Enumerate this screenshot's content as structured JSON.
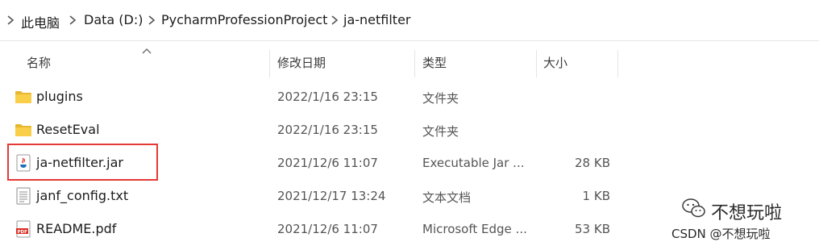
{
  "breadcrumb": {
    "items": [
      "此电脑",
      "Data (D:)",
      "PycharmProfessionProject",
      "ja-netfilter"
    ]
  },
  "columns": {
    "name": "名称",
    "modified": "修改日期",
    "type": "类型",
    "size": "大小"
  },
  "files": [
    {
      "name": "plugins",
      "modified": "2022/1/16 23:15",
      "type": "文件夹",
      "size": "",
      "icon": "folder-icon"
    },
    {
      "name": "ResetEval",
      "modified": "2022/1/16 23:15",
      "type": "文件夹",
      "size": "",
      "icon": "folder-icon"
    },
    {
      "name": "ja-netfilter.jar",
      "modified": "2021/12/6 11:07",
      "type": "Executable Jar ...",
      "size": "28 KB",
      "icon": "java-jar-icon"
    },
    {
      "name": "janf_config.txt",
      "modified": "2021/12/17 13:24",
      "type": "文本文档",
      "size": "1 KB",
      "icon": "text-file-icon"
    },
    {
      "name": "README.pdf",
      "modified": "2021/12/6 11:07",
      "type": "Microsoft Edge ...",
      "size": "53 KB",
      "icon": "pdf-icon"
    }
  ],
  "watermark": {
    "account": "不想玩啦",
    "credit": "CSDN @不想玩啦"
  },
  "colors": {
    "highlight": "#e53935",
    "folder": "#f4c542"
  }
}
